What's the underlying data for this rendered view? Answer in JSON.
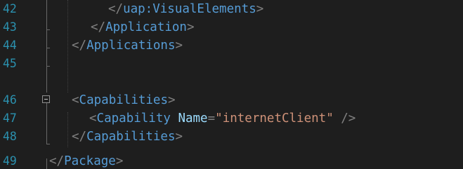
{
  "lines": [
    {
      "number": "42",
      "parts": [
        "</",
        "uap:VisualElements",
        ">"
      ]
    },
    {
      "number": "43",
      "parts": [
        "</",
        "Application",
        ">"
      ]
    },
    {
      "number": "44",
      "parts": [
        "</",
        "Applications",
        ">"
      ]
    },
    {
      "number": "45",
      "parts": []
    },
    {
      "number": "46",
      "parts": [
        "<",
        "Capabilities",
        ">"
      ]
    },
    {
      "number": "47",
      "parts": [
        "<",
        "Capability",
        " ",
        "Name",
        "=",
        "\"internetClient\"",
        " />"
      ]
    },
    {
      "number": "48",
      "parts": [
        "</",
        "Capabilities",
        ">"
      ]
    },
    {
      "number": "49",
      "parts": [
        "</",
        "Package",
        ">"
      ]
    }
  ],
  "colors": {
    "background": "#1e1e1e",
    "line_number": "#2b91af",
    "tag_name": "#569cd6",
    "punctuation": "#808080",
    "attribute": "#9cdcfe",
    "string": "#ce9178"
  },
  "icons": {
    "fold": "collapse-minus-icon"
  }
}
